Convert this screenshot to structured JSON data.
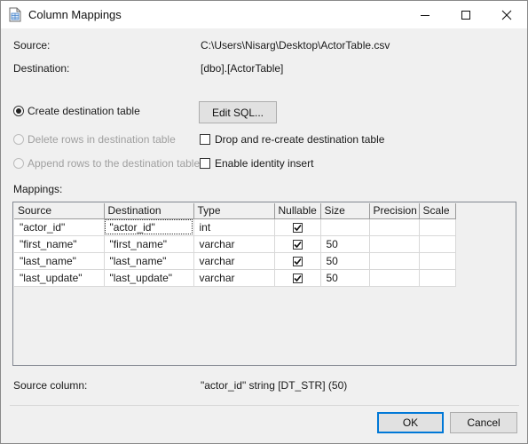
{
  "window": {
    "title": "Column Mappings"
  },
  "info": {
    "source_label": "Source:",
    "source_value": "C:\\Users\\Nisarg\\Desktop\\ActorTable.csv",
    "destination_label": "Destination:",
    "destination_value": "[dbo].[ActorTable]"
  },
  "options": {
    "create_label": "Create destination table",
    "create_selected": true,
    "delete_label": "Delete rows in destination table",
    "append_label": "Append rows to the destination table",
    "edit_sql_label": "Edit SQL...",
    "drop_recreate_label": "Drop and re-create destination table",
    "drop_recreate_checked": false,
    "identity_insert_label": "Enable identity insert",
    "identity_insert_checked": false
  },
  "mappings": {
    "label": "Mappings:",
    "columns": [
      "Source",
      "Destination",
      "Type",
      "Nullable",
      "Size",
      "Precision",
      "Scale"
    ],
    "rows": [
      {
        "source": "\"actor_id\"",
        "destination": "\"actor_id\"",
        "type": "int",
        "nullable": true,
        "size": "",
        "precision": "",
        "scale": ""
      },
      {
        "source": "\"first_name\"",
        "destination": "\"first_name\"",
        "type": "varchar",
        "nullable": true,
        "size": "50",
        "precision": "",
        "scale": ""
      },
      {
        "source": "\"last_name\"",
        "destination": "\"last_name\"",
        "type": "varchar",
        "nullable": true,
        "size": "50",
        "precision": "",
        "scale": ""
      },
      {
        "source": "\"last_update\"",
        "destination": "\"last_update\"",
        "type": "varchar",
        "nullable": true,
        "size": "50",
        "precision": "",
        "scale": ""
      }
    ]
  },
  "footer": {
    "source_column_label": "Source column:",
    "source_column_value": "\"actor_id\" string [DT_STR] (50)",
    "ok_label": "OK",
    "cancel_label": "Cancel"
  },
  "colors": {
    "focus_border": "#0078d7",
    "dialog_bg": "#f0f0f0"
  },
  "icons": {
    "title": "table-document-icon"
  }
}
